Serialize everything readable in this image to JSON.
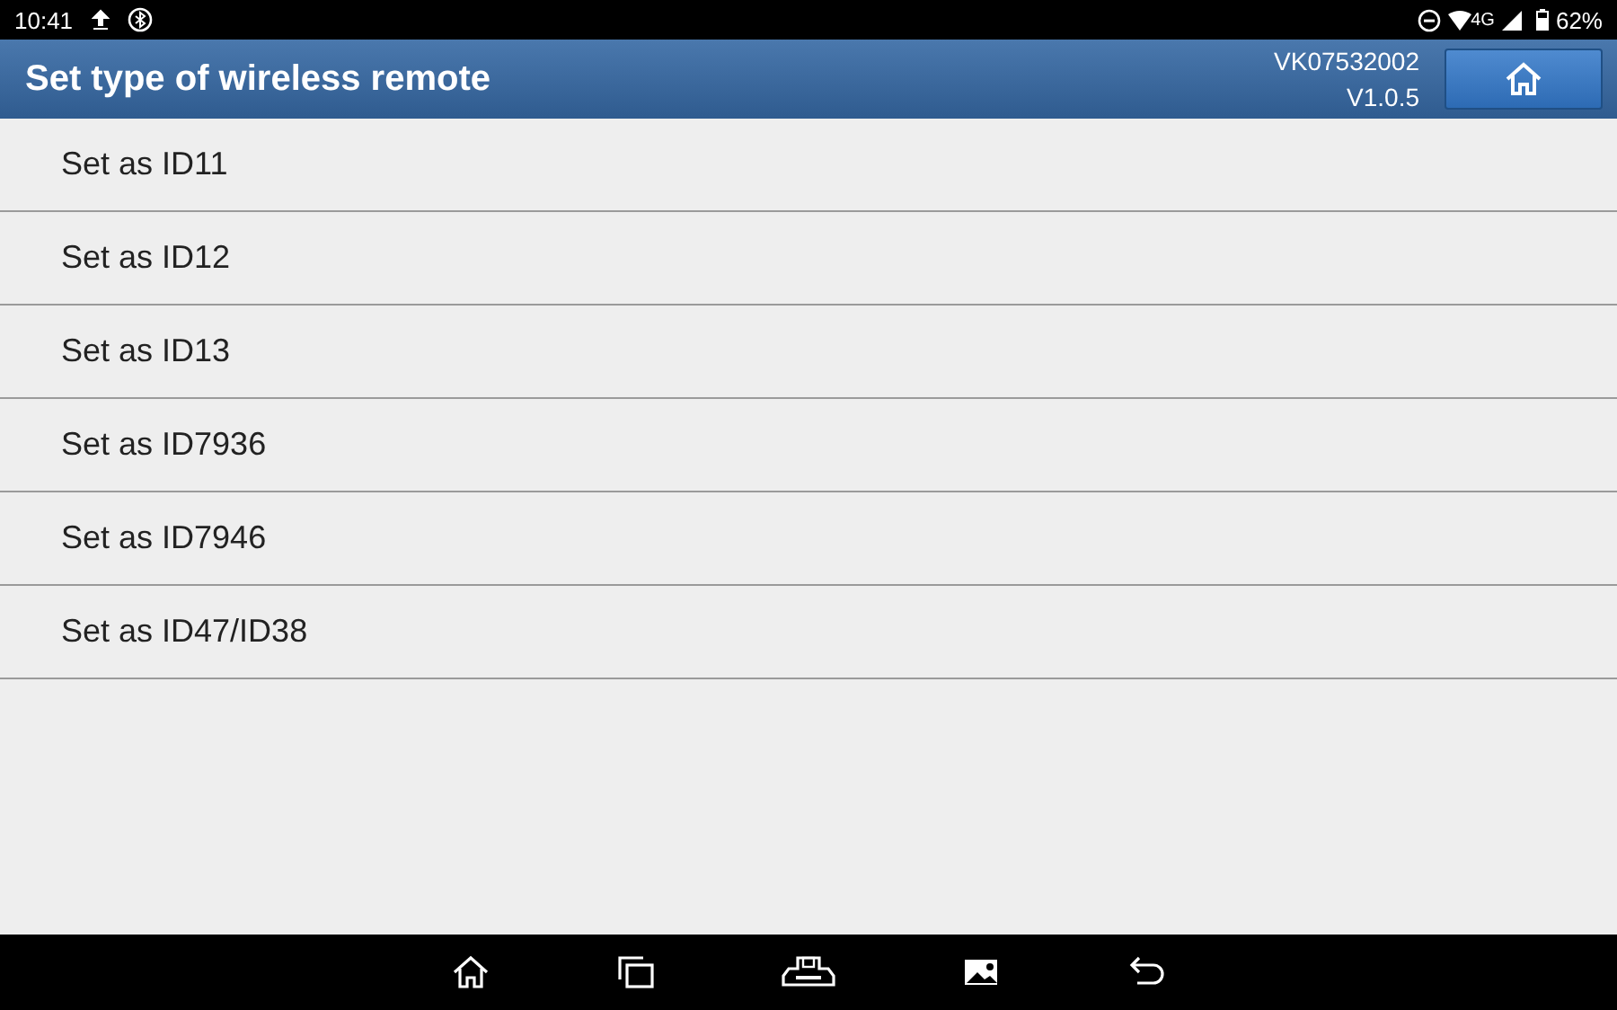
{
  "status_bar": {
    "time": "10:41",
    "network": "4G",
    "battery": "62%"
  },
  "header": {
    "title": "Set type of wireless remote",
    "serial": "VK07532002",
    "version": "V1.0.5"
  },
  "items": [
    {
      "label": "Set as ID11"
    },
    {
      "label": "Set as ID12"
    },
    {
      "label": "Set as ID13"
    },
    {
      "label": "Set as ID7936"
    },
    {
      "label": "Set as ID7946"
    },
    {
      "label": "Set as ID47/ID38"
    }
  ]
}
